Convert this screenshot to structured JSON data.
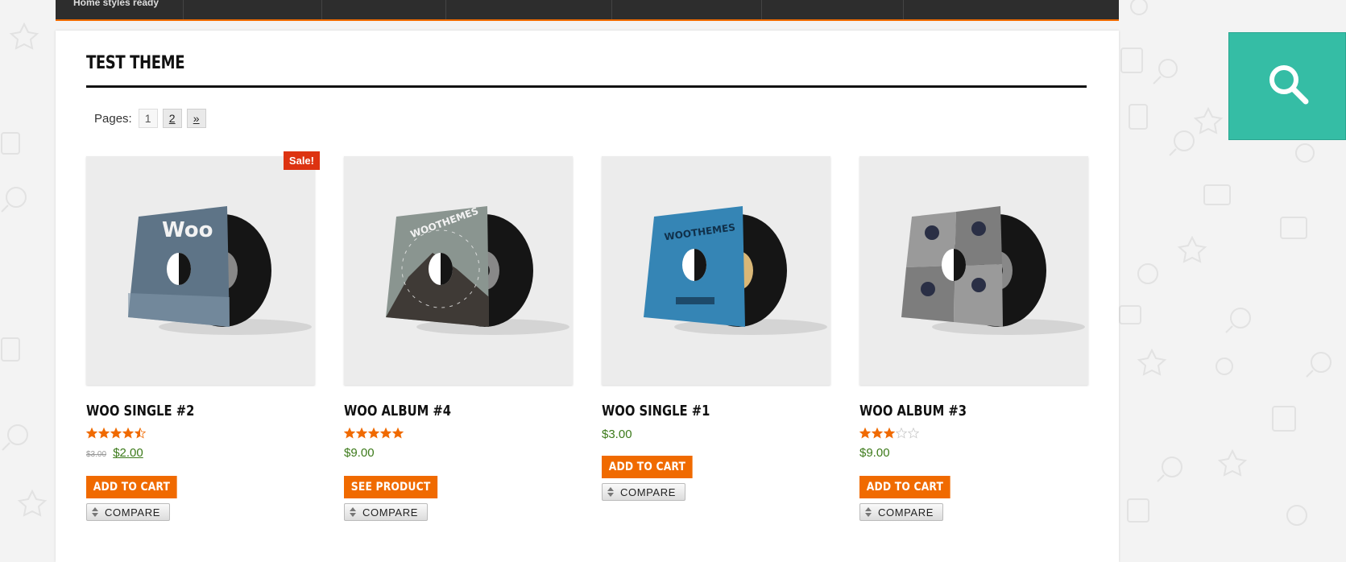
{
  "nav": {
    "label": "Home styles ready"
  },
  "page": {
    "title": "TEST THEME"
  },
  "pagination": {
    "label": "Pages:",
    "pages": [
      "1",
      "2"
    ],
    "next": "»"
  },
  "products": [
    {
      "name": "WOO SINGLE #2",
      "badge": "Sale!",
      "rating": 4.5,
      "price_old": "$3.00",
      "price": "$2.00",
      "action": "ADD TO CART",
      "compare": "COMPARE",
      "cover": "woo-single-2-cover"
    },
    {
      "name": "WOO ALBUM #4",
      "rating": 5,
      "price": "$9.00",
      "action": "SEE PRODUCT",
      "compare": "COMPARE",
      "cover": "woo-album-4-cover"
    },
    {
      "name": "WOO SINGLE #1",
      "price": "$3.00",
      "action": "ADD TO CART",
      "compare": "COMPARE",
      "cover": "woo-single-1-cover"
    },
    {
      "name": "WOO ALBUM #3",
      "rating": 3,
      "price": "$9.00",
      "action": "ADD TO CART",
      "compare": "COMPARE",
      "cover": "woo-album-3-cover"
    }
  ],
  "cover_text": {
    "woo": "Woo",
    "woothemes": "WOOTHEMES"
  },
  "colors": {
    "accent": "#f06a00",
    "sale": "#dd3311",
    "price": "#3c7a1a",
    "search": "#35bda5",
    "nav": "#2d2d2d"
  },
  "icons": {
    "search": "search-icon",
    "compare": "sort-arrows-icon",
    "star": "star-icon"
  }
}
